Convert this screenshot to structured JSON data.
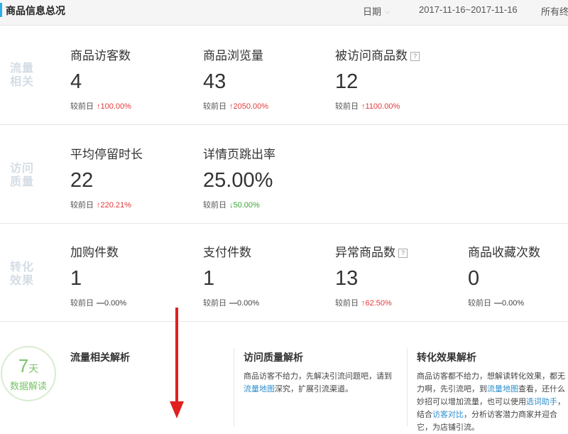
{
  "header": {
    "title": "商品信息总况",
    "date_label": "日期",
    "date_range": "2017-11-16~2017-11-16",
    "terminal": "所有终端"
  },
  "sections": {
    "traffic": {
      "label": "流量相关",
      "metrics": [
        {
          "name": "商品访客数",
          "value": "4",
          "compare": "较前日",
          "change": "100.00%",
          "trend": "up"
        },
        {
          "name": "商品浏览量",
          "value": "43",
          "compare": "较前日",
          "change": "2050.00%",
          "trend": "up"
        },
        {
          "name": "被访问商品数",
          "value": "12",
          "compare": "较前日",
          "change": "1100.00%",
          "trend": "up",
          "help": "?"
        }
      ]
    },
    "quality": {
      "label": "访问质量",
      "metrics": [
        {
          "name": "平均停留时长",
          "value": "22",
          "compare": "较前日",
          "change": "220.21%",
          "trend": "up"
        },
        {
          "name": "详情页跳出率",
          "value": "25.00%",
          "compare": "较前日",
          "change": "50.00%",
          "trend": "down"
        }
      ]
    },
    "conversion": {
      "label": "转化效果",
      "metrics": [
        {
          "name": "加购件数",
          "value": "1",
          "compare": "较前日",
          "change": "0.00%",
          "trend": "flat"
        },
        {
          "name": "支付件数",
          "value": "1",
          "compare": "较前日",
          "change": "0.00%",
          "trend": "flat"
        },
        {
          "name": "异常商品数",
          "value": "13",
          "compare": "较前日",
          "change": "62.50%",
          "trend": "up",
          "help": "?"
        },
        {
          "name": "商品收藏次数",
          "value": "0",
          "compare": "较前日",
          "change": "0.00%",
          "trend": "flat"
        }
      ]
    }
  },
  "icons": {
    "trend_up": "arrow-up-icon",
    "trend_down": "arrow-down-icon",
    "trend_flat": "dash-icon",
    "help": "question-icon",
    "date_dropdown": "chevron-down-icon"
  },
  "colors": {
    "accent": "#2eaee5",
    "up": "#e4393c",
    "down": "#3aa53a",
    "circle": "#7cc36b",
    "side_label": "#d4dde6",
    "annotation_arrow": "#e02020"
  },
  "badge": {
    "number": "7",
    "unit": "天",
    "caption": "数据解读"
  },
  "analysis": [
    {
      "title": "流量相关解析",
      "text": ""
    },
    {
      "title": "访问质量解析",
      "text_before": "商品访客不给力，先解决引流问题吧，请到",
      "link": "流量地图",
      "text_after": "深究，扩展引流渠道。"
    },
    {
      "title": "转化效果解析",
      "text_before": "商品访客都不给力，想解读转化效果，都无力啊，先引流吧，到",
      "link": "流量地图",
      "text_middle": "查看，还什么妙招可以增加流量，也可以使用",
      "link2": "选词助手",
      "text_middle2": "，结合",
      "link3": "访客对比",
      "text_after": "，分析访客潜力商家并迎合它，为店铺引流。"
    }
  ]
}
